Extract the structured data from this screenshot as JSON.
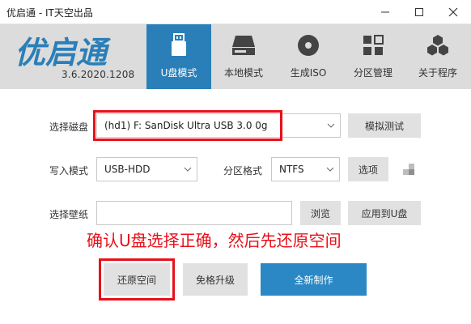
{
  "window": {
    "title": "优启通 - IT天空出品",
    "controls": [
      "minimize-icon",
      "maximize-icon",
      "close-icon"
    ]
  },
  "header": {
    "logo_text": "优启通",
    "version": "3.6.2020.1208",
    "tabs": [
      {
        "label": "U盘模式",
        "icon": "usb-drive-icon",
        "active": true
      },
      {
        "label": "本地模式",
        "icon": "hard-disk-icon",
        "active": false
      },
      {
        "label": "生成ISO",
        "icon": "disc-icon",
        "active": false
      },
      {
        "label": "分区管理",
        "icon": "grid-icon",
        "active": false
      },
      {
        "label": "关于程序",
        "icon": "cubes-icon",
        "active": false
      }
    ]
  },
  "form": {
    "disk_label": "选择磁盘",
    "disk_value": "(hd1) F: SanDisk Ultra USB 3.0 0g",
    "simulate_button": "模拟测试",
    "write_mode_label": "写入模式",
    "write_mode_value": "USB-HDD",
    "partition_format_label": "分区格式",
    "partition_format_value": "NTFS",
    "options_button": "选项",
    "wallpaper_label": "选择壁纸",
    "wallpaper_value": "",
    "browse_button": "浏览",
    "apply_usb_button": "应用到U盘"
  },
  "annotation": "确认U盘选择正确，然后先还原空间",
  "actions": {
    "restore_button": "还原空间",
    "upgrade_button": "免格升级",
    "create_button": "全新制作"
  },
  "colors": {
    "accent": "#2a7fb8",
    "primary_button": "#2b88c4",
    "highlight_red": "#e8101a",
    "header_bg": "#dcdcdc"
  }
}
